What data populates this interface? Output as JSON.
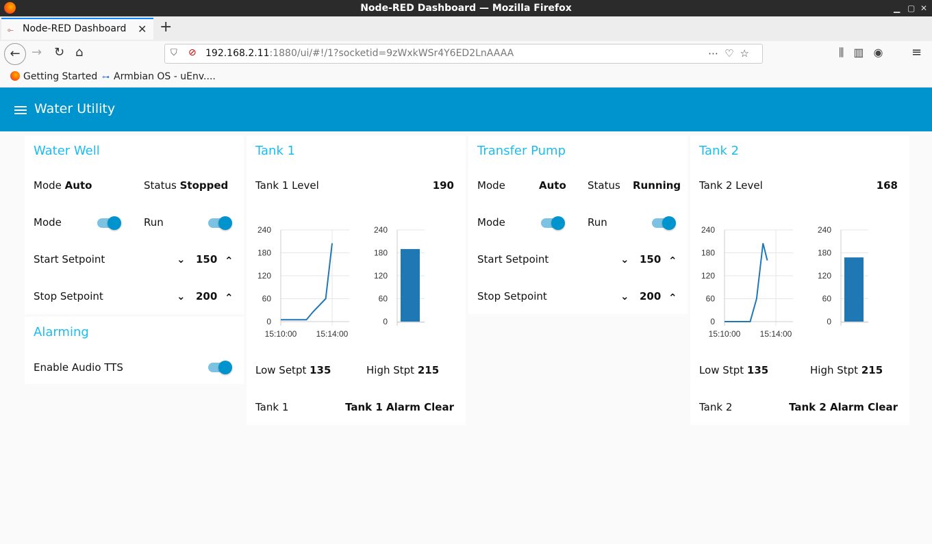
{
  "window": {
    "title": "Node-RED Dashboard — Mozilla Firefox"
  },
  "browser": {
    "tab_label": "Node-RED Dashboard",
    "url_host": "192.168.2.11",
    "url_path": ":1880/ui/#!/1?socketid=9zWxkWSr4Y6ED2LnAAAA",
    "bookmarks": [
      "Getting Started",
      "Armbian OS - uEnv...."
    ]
  },
  "app": {
    "title": "Water Utility"
  },
  "water_well": {
    "title": "Water Well",
    "mode_label": "Mode",
    "mode_value": "Auto",
    "status_label": "Status",
    "status_value": "Stopped",
    "mode_toggle_label": "Mode",
    "run_toggle_label": "Run",
    "start_label": "Start Setpoint",
    "start_value": "150",
    "stop_label": "Stop Setpoint",
    "stop_value": "200"
  },
  "alarming": {
    "title": "Alarming",
    "tts_label": "Enable Audio TTS"
  },
  "tank1": {
    "title": "Tank 1",
    "level_label": "Tank 1 Level",
    "level_value": "190",
    "low_label": "Low Setpt",
    "low_value": "135",
    "high_label": "High Stpt",
    "high_value": "215",
    "alarm_label": "Tank 1",
    "alarm_value": "Tank 1 Alarm Clear"
  },
  "pump": {
    "title": "Transfer Pump",
    "mode_label": "Mode",
    "mode_value": "Auto",
    "status_label": "Status",
    "status_value": "Running",
    "mode_toggle_label": "Mode",
    "run_toggle_label": "Run",
    "start_label": "Start Setpoint",
    "start_value": "150",
    "stop_label": "Stop Setpoint",
    "stop_value": "200"
  },
  "tank2": {
    "title": "Tank 2",
    "level_label": "Tank 2 Level",
    "level_value": "168",
    "low_label": "Low Stpt",
    "low_value": "135",
    "high_label": "High Stpt",
    "high_value": "215",
    "alarm_label": "Tank 2",
    "alarm_value": "Tank 2 Alarm Clear"
  },
  "colors": {
    "header": "#0094ce",
    "title_accent": "#1bbcf0",
    "series": "#1f77b4"
  },
  "chart_data": [
    {
      "type": "line",
      "x": [
        "15:10:00",
        "15:12:00",
        "15:12:30",
        "15:13:30",
        "15:14:00"
      ],
      "series": [
        {
          "values": [
            5,
            5,
            25,
            60,
            205
          ]
        }
      ],
      "ylim": [
        0,
        240
      ],
      "yticks": [
        "0",
        "60",
        "120",
        "180",
        "240"
      ],
      "xticks": [
        "15:10:00",
        "15:14:00"
      ]
    },
    {
      "type": "bar",
      "categories": [
        ""
      ],
      "values": [
        190
      ],
      "ylim": [
        0,
        240
      ],
      "yticks": [
        "0",
        "60",
        "120",
        "180",
        "240"
      ]
    },
    {
      "type": "line",
      "x": [
        "15:10:00",
        "15:12:00",
        "15:12:30",
        "15:13:00",
        "15:13:20"
      ],
      "series": [
        {
          "values": [
            0,
            0,
            60,
            205,
            160
          ]
        }
      ],
      "ylim": [
        0,
        240
      ],
      "yticks": [
        "0",
        "60",
        "120",
        "180",
        "240"
      ],
      "xticks": [
        "15:10:00",
        "15:14:00"
      ]
    },
    {
      "type": "bar",
      "categories": [
        ""
      ],
      "values": [
        168
      ],
      "ylim": [
        0,
        240
      ],
      "yticks": [
        "0",
        "60",
        "120",
        "180",
        "240"
      ]
    }
  ]
}
